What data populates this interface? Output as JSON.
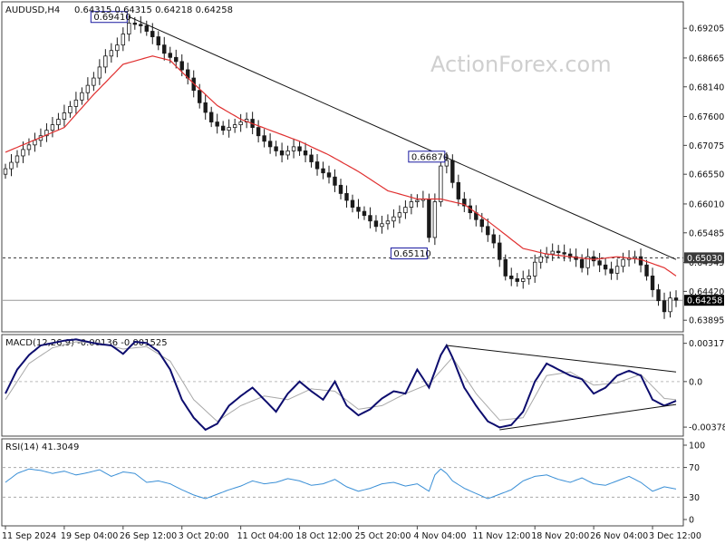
{
  "header": {
    "symbol": "AUDUSD,H4",
    "ohlc": "0.64315 0.64315 0.64218 0.64258"
  },
  "watermark": "ActionForex.com",
  "chart_data": [
    {
      "type": "candlestick",
      "name_label": "AUDUSD,H4",
      "ylim": [
        0.6375,
        0.6962
      ],
      "y_ticks": [
        "0.69205",
        "0.68665",
        "0.68140",
        "0.67600",
        "0.67075",
        "0.66550",
        "0.66010",
        "0.65485",
        "0.64945",
        "0.64420",
        "0.63895"
      ],
      "y_tick_values": [
        0.69205,
        0.68665,
        0.6814,
        0.676,
        0.67075,
        0.6655,
        0.6601,
        0.65485,
        0.64945,
        0.6442,
        0.63895
      ],
      "x_ticks": [
        "11 Sep 2024",
        "19 Sep 04:00",
        "26 Sep 12:00",
        "3 Oct 20:00",
        "11 Oct 04:00",
        "18 Oct 12:00",
        "25 Oct 20:00",
        "4 Nov 04:00",
        "11 Nov 12:00",
        "18 Nov 20:00",
        "26 Nov 04:00",
        "3 Dec 12:00"
      ],
      "x_tick_index": [
        0,
        10,
        20,
        30,
        40,
        50,
        60,
        70,
        80,
        90,
        100,
        110
      ],
      "bar_count": 115,
      "close_path": [
        [
          0,
          0.6665
        ],
        [
          3,
          0.67
        ],
        [
          6,
          0.6725
        ],
        [
          9,
          0.6755
        ],
        [
          12,
          0.679
        ],
        [
          15,
          0.683
        ],
        [
          17,
          0.687
        ],
        [
          19,
          0.689
        ],
        [
          21,
          0.693
        ],
        [
          23,
          0.6925
        ],
        [
          25,
          0.6905
        ],
        [
          27,
          0.6875
        ],
        [
          29,
          0.686
        ],
        [
          31,
          0.683
        ],
        [
          33,
          0.6785
        ],
        [
          35,
          0.675
        ],
        [
          37,
          0.6735
        ],
        [
          39,
          0.6745
        ],
        [
          41,
          0.6755
        ],
        [
          43,
          0.6725
        ],
        [
          45,
          0.6705
        ],
        [
          47,
          0.669
        ],
        [
          49,
          0.6705
        ],
        [
          51,
          0.669
        ],
        [
          53,
          0.6665
        ],
        [
          55,
          0.665
        ],
        [
          57,
          0.662
        ],
        [
          59,
          0.6595
        ],
        [
          61,
          0.658
        ],
        [
          63,
          0.656
        ],
        [
          65,
          0.657
        ],
        [
          67,
          0.6585
        ],
        [
          69,
          0.6605
        ],
        [
          71,
          0.661
        ],
        [
          72,
          0.654
        ],
        [
          73,
          0.6605
        ],
        [
          74,
          0.667
        ],
        [
          75,
          0.668
        ],
        [
          76,
          0.664
        ],
        [
          77,
          0.661
        ],
        [
          79,
          0.6585
        ],
        [
          81,
          0.656
        ],
        [
          83,
          0.653
        ],
        [
          84,
          0.65
        ],
        [
          85,
          0.647
        ],
        [
          87,
          0.646
        ],
        [
          89,
          0.647
        ],
        [
          90,
          0.6495
        ],
        [
          91,
          0.6505
        ],
        [
          93,
          0.6515
        ],
        [
          95,
          0.651
        ],
        [
          97,
          0.65
        ],
        [
          98,
          0.6485
        ],
        [
          99,
          0.6505
        ],
        [
          101,
          0.649
        ],
        [
          103,
          0.6475
        ],
        [
          105,
          0.65
        ],
        [
          107,
          0.6505
        ],
        [
          108,
          0.649
        ],
        [
          109,
          0.647
        ],
        [
          110,
          0.6445
        ],
        [
          111,
          0.6425
        ],
        [
          112,
          0.6405
        ],
        [
          113,
          0.643
        ],
        [
          114,
          0.6426
        ]
      ],
      "ma_path": [
        [
          0,
          0.6695
        ],
        [
          10,
          0.674
        ],
        [
          15,
          0.68
        ],
        [
          20,
          0.6855
        ],
        [
          25,
          0.687
        ],
        [
          28,
          0.6862
        ],
        [
          32,
          0.682
        ],
        [
          36,
          0.678
        ],
        [
          40,
          0.6755
        ],
        [
          45,
          0.6735
        ],
        [
          50,
          0.6715
        ],
        [
          55,
          0.669
        ],
        [
          60,
          0.666
        ],
        [
          65,
          0.6625
        ],
        [
          70,
          0.661
        ],
        [
          74,
          0.661
        ],
        [
          78,
          0.66
        ],
        [
          82,
          0.657
        ],
        [
          85,
          0.6545
        ],
        [
          88,
          0.652
        ],
        [
          92,
          0.651
        ],
        [
          96,
          0.6505
        ],
        [
          100,
          0.65
        ],
        [
          104,
          0.6505
        ],
        [
          108,
          0.65
        ],
        [
          112,
          0.6485
        ],
        [
          114,
          0.647
        ]
      ],
      "trendline": [
        [
          21,
          0.69415
        ],
        [
          114,
          0.65
        ]
      ],
      "hline_dashed": 0.6503,
      "hline_solid": 0.64258,
      "annotations": [
        {
          "text": "0.69410",
          "x": 21,
          "y": 0.6941
        },
        {
          "text": "0.66870",
          "x": 75,
          "y": 0.6687
        },
        {
          "text": "0.65110",
          "x": 72,
          "y": 0.6511
        }
      ],
      "price_badges": [
        {
          "text": "0.65030",
          "value": 0.6503,
          "color": "#3a3a3a"
        },
        {
          "text": "0.64258",
          "value": 0.64258,
          "color": "#000000"
        }
      ],
      "colors": {
        "candle": "#1a1a1a",
        "ma": "#e03030",
        "trend": "#111111"
      }
    },
    {
      "type": "line",
      "title": "MACD(12,26,9) -0.00136 -0.001525",
      "ylim": [
        -0.0043,
        0.0036
      ],
      "y_ticks": [
        "0.003175",
        "0.0",
        "-0.00378"
      ],
      "y_tick_values": [
        0.003175,
        0.0,
        -0.00378
      ],
      "macd_path": [
        [
          0,
          -0.001
        ],
        [
          2,
          0.001
        ],
        [
          4,
          0.0022
        ],
        [
          6,
          0.003
        ],
        [
          8,
          0.0032
        ],
        [
          10,
          0.0034
        ],
        [
          12,
          0.0035
        ],
        [
          14,
          0.0033
        ],
        [
          16,
          0.0031
        ],
        [
          18,
          0.003
        ],
        [
          20,
          0.0023
        ],
        [
          22,
          0.0033
        ],
        [
          24,
          0.0032
        ],
        [
          26,
          0.0025
        ],
        [
          28,
          0.001
        ],
        [
          30,
          -0.0015
        ],
        [
          32,
          -0.003
        ],
        [
          34,
          -0.004
        ],
        [
          36,
          -0.0035
        ],
        [
          38,
          -0.002
        ],
        [
          40,
          -0.0012
        ],
        [
          42,
          -0.0005
        ],
        [
          44,
          -0.0015
        ],
        [
          46,
          -0.0025
        ],
        [
          48,
          -0.001
        ],
        [
          50,
          0.0
        ],
        [
          52,
          -0.0008
        ],
        [
          54,
          -0.0015
        ],
        [
          56,
          0.0
        ],
        [
          58,
          -0.002
        ],
        [
          60,
          -0.0028
        ],
        [
          62,
          -0.0023
        ],
        [
          64,
          -0.0014
        ],
        [
          66,
          -0.0008
        ],
        [
          68,
          -0.001
        ],
        [
          70,
          0.001
        ],
        [
          72,
          -0.0005
        ],
        [
          74,
          0.0022
        ],
        [
          75,
          0.003
        ],
        [
          76,
          0.002
        ],
        [
          78,
          -0.0005
        ],
        [
          80,
          -0.002
        ],
        [
          82,
          -0.0033
        ],
        [
          84,
          -0.0038
        ],
        [
          86,
          -0.0036
        ],
        [
          88,
          -0.0025
        ],
        [
          90,
          0.0
        ],
        [
          92,
          0.0015
        ],
        [
          94,
          0.001
        ],
        [
          96,
          0.0005
        ],
        [
          98,
          0.0002
        ],
        [
          100,
          -0.001
        ],
        [
          102,
          -0.0005
        ],
        [
          104,
          0.0005
        ],
        [
          106,
          0.0009
        ],
        [
          108,
          0.0005
        ],
        [
          110,
          -0.0015
        ],
        [
          112,
          -0.002
        ],
        [
          114,
          -0.0016
        ]
      ],
      "signal_path": [
        [
          0,
          -0.0015
        ],
        [
          4,
          0.0015
        ],
        [
          8,
          0.0028
        ],
        [
          12,
          0.0033
        ],
        [
          16,
          0.0032
        ],
        [
          20,
          0.0027
        ],
        [
          24,
          0.0029
        ],
        [
          28,
          0.0017
        ],
        [
          32,
          -0.0015
        ],
        [
          36,
          -0.0033
        ],
        [
          40,
          -0.002
        ],
        [
          44,
          -0.0012
        ],
        [
          48,
          -0.0015
        ],
        [
          52,
          -0.0006
        ],
        [
          56,
          -0.0008
        ],
        [
          60,
          -0.0023
        ],
        [
          64,
          -0.002
        ],
        [
          68,
          -0.001
        ],
        [
          72,
          -0.0002
        ],
        [
          76,
          0.002
        ],
        [
          80,
          -0.001
        ],
        [
          84,
          -0.0032
        ],
        [
          88,
          -0.003
        ],
        [
          92,
          0.0005
        ],
        [
          96,
          0.0008
        ],
        [
          100,
          -0.0003
        ],
        [
          104,
          -0.0001
        ],
        [
          108,
          0.0006
        ],
        [
          112,
          -0.0014
        ],
        [
          114,
          -0.0015
        ]
      ],
      "trend_upper": [
        [
          75,
          0.003
        ],
        [
          114,
          0.0008
        ]
      ],
      "trend_lower": [
        [
          84,
          -0.004
        ],
        [
          114,
          -0.0019
        ]
      ],
      "colors": {
        "macd": "#0d0d6e",
        "signal": "#a8a8a8"
      }
    },
    {
      "type": "line",
      "title": "RSI(14) 41.3049",
      "ylim": [
        0,
        100
      ],
      "y_ticks": [
        "100",
        "70",
        "30",
        "0"
      ],
      "y_tick_values": [
        100,
        70,
        30,
        0
      ],
      "levels": [
        70,
        30
      ],
      "rsi_path": [
        [
          0,
          50
        ],
        [
          2,
          62
        ],
        [
          4,
          68
        ],
        [
          6,
          66
        ],
        [
          8,
          62
        ],
        [
          10,
          65
        ],
        [
          12,
          60
        ],
        [
          14,
          63
        ],
        [
          16,
          67
        ],
        [
          18,
          58
        ],
        [
          20,
          64
        ],
        [
          22,
          62
        ],
        [
          24,
          50
        ],
        [
          26,
          52
        ],
        [
          28,
          48
        ],
        [
          30,
          40
        ],
        [
          32,
          33
        ],
        [
          34,
          28
        ],
        [
          36,
          34
        ],
        [
          38,
          40
        ],
        [
          40,
          45
        ],
        [
          42,
          52
        ],
        [
          44,
          48
        ],
        [
          46,
          50
        ],
        [
          48,
          55
        ],
        [
          50,
          52
        ],
        [
          52,
          46
        ],
        [
          54,
          48
        ],
        [
          56,
          54
        ],
        [
          58,
          44
        ],
        [
          60,
          38
        ],
        [
          62,
          42
        ],
        [
          64,
          48
        ],
        [
          66,
          50
        ],
        [
          68,
          45
        ],
        [
          70,
          48
        ],
        [
          72,
          38
        ],
        [
          73,
          60
        ],
        [
          74,
          68
        ],
        [
          75,
          62
        ],
        [
          76,
          52
        ],
        [
          78,
          42
        ],
        [
          80,
          35
        ],
        [
          82,
          28
        ],
        [
          84,
          34
        ],
        [
          86,
          40
        ],
        [
          88,
          52
        ],
        [
          90,
          58
        ],
        [
          92,
          60
        ],
        [
          94,
          54
        ],
        [
          96,
          50
        ],
        [
          98,
          56
        ],
        [
          100,
          48
        ],
        [
          102,
          46
        ],
        [
          104,
          52
        ],
        [
          106,
          58
        ],
        [
          108,
          50
        ],
        [
          110,
          38
        ],
        [
          112,
          44
        ],
        [
          114,
          41
        ]
      ],
      "colors": {
        "rsi": "#3a8fd6",
        "level": "#aaaaaa"
      }
    }
  ]
}
